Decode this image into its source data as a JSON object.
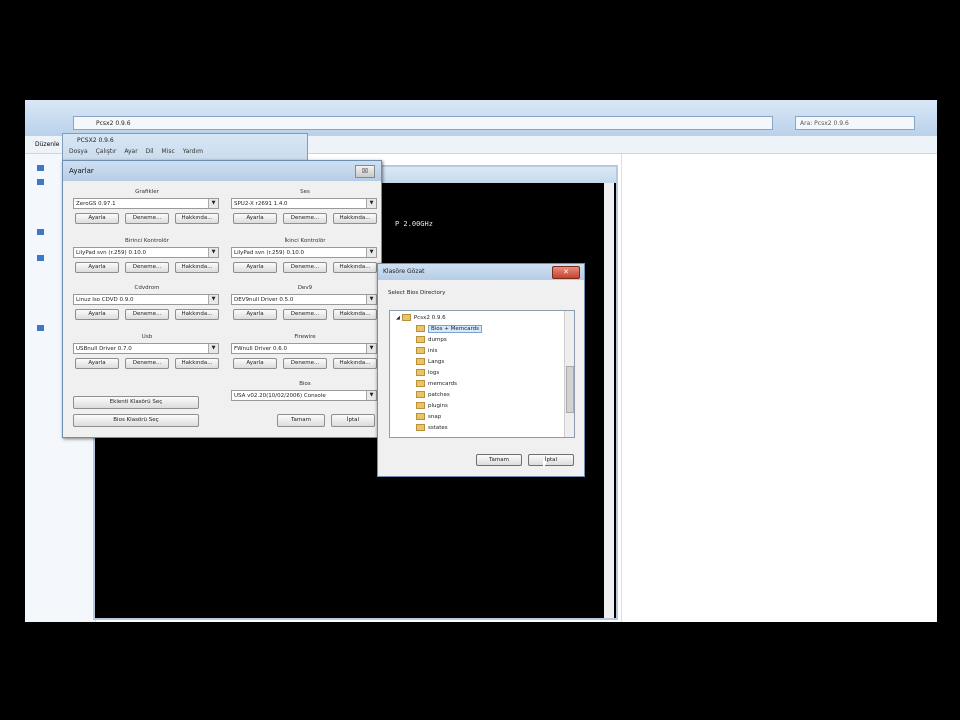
{
  "explorer": {
    "address": "Pcsx2 0.9.6",
    "search_placeholder": "Ara: Pcsx2 0.9.6",
    "menu_label": "Düzenle"
  },
  "console": {
    "text": "P 2.00GHz"
  },
  "pcsx2": {
    "title": "PCSX2 0.9.6",
    "menu": [
      "Dosya",
      "Çalıştır",
      "Ayar",
      "Dil",
      "Misc",
      "Yardım"
    ]
  },
  "ayarlar": {
    "title": "Ayarlar",
    "close": "☒",
    "groups": [
      {
        "label": "Grafikler",
        "value": "ZeroGS 0.97.1"
      },
      {
        "label": "Ses",
        "value": "SPU2-X r2691 1.4.0"
      },
      {
        "label": "Birinci Kontrolör",
        "value": "LilyPad svn (r.259) 0.10.0"
      },
      {
        "label": "İkinci Kontrolör",
        "value": "LilyPad svn (r.259) 0.10.0"
      },
      {
        "label": "Cdvdrom",
        "value": "Linuz Iso CDVD 0.9.0"
      },
      {
        "label": "Dev9",
        "value": "DEV9null Driver 0.5.0"
      },
      {
        "label": "Usb",
        "value": "USBnull Driver 0.7.0"
      },
      {
        "label": "Firewire",
        "value": "FWnull Driver 0.6.0"
      }
    ],
    "buttons": {
      "configure": "Ayarla",
      "test": "Deneme...",
      "about": "Hakkında..."
    },
    "bios_label": "Bios",
    "bios_value": "USA   v02.20(10/02/2006) Console",
    "plugins_dir_btn": "Eklenti Klasörü Seç",
    "bios_dir_btn": "Bios Klasörü Seç",
    "ok": "Tamam",
    "cancel": "İptal"
  },
  "browse": {
    "title": "Klasöre Gözat",
    "close": "✕",
    "description": "Select Bios Directory",
    "root": "Pcsx2 0.9.6",
    "folders": [
      "Bios + Memcards",
      "dumps",
      "inis",
      "Langs",
      "logs",
      "memcards",
      "patches",
      "plugins",
      "snap",
      "sstates"
    ],
    "selected_index": 0,
    "ok": "Tamam",
    "cancel": "İptal"
  }
}
